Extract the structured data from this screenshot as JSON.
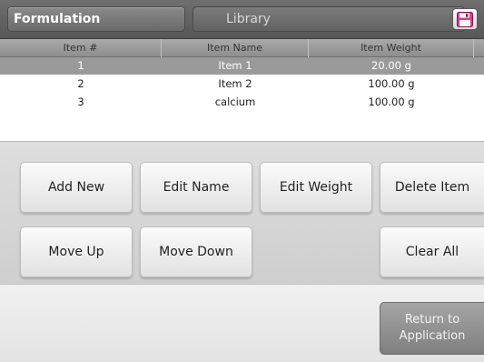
{
  "header": {
    "active_tab": "Formulation",
    "inactive_tab": "Library",
    "save_icon": "floppy-disk-icon"
  },
  "table": {
    "columns": [
      "Item #",
      "Item Name",
      "Item Weight"
    ],
    "rows": [
      {
        "num": "1",
        "name": "Item 1",
        "weight": "20.00 g",
        "selected": true
      },
      {
        "num": "2",
        "name": "Item 2",
        "weight": "100.00 g",
        "selected": false
      },
      {
        "num": "3",
        "name": "calcium",
        "weight": "100.00 g",
        "selected": false
      }
    ]
  },
  "buttons": {
    "add_new": "Add New",
    "edit_name": "Edit Name",
    "edit_weight": "Edit Weight",
    "delete_item": "Delete Item",
    "move_up": "Move Up",
    "move_down": "Move Down",
    "clear_all": "Clear All"
  },
  "footer": {
    "return_line1": "Return to",
    "return_line2": "Application"
  },
  "colors": {
    "header_bg": "#5f5f5f",
    "selected_row": "#9a9a9a",
    "panel_bg": "#d6d6d6"
  }
}
